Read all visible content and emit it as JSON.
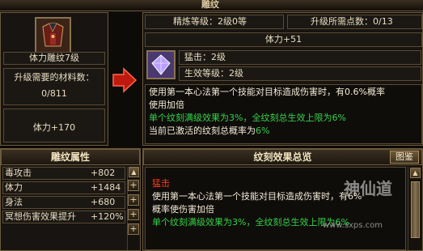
{
  "window": {
    "title": "雕纹"
  },
  "left": {
    "item_name": "体力雕纹7级",
    "materials_label": "升级需要的材料数：",
    "materials_value": "0/811",
    "stat_value": "体力+170"
  },
  "right_top": {
    "refine_level": "精炼等级：2级0等",
    "upgrade_points": "升级所需点数：0/13",
    "stat_bar": "体力+51",
    "skill_name": "猛击：2级",
    "effect_level": "生效等级：2级",
    "desc_line1": "使用第一本心法第一个技能对目标造成伤害时，有0.6%概率",
    "desc_line2": "使用加倍",
    "desc_green1": "单个纹刻满级效果为3%，全纹刻总生效上限为6%",
    "desc_line3_prefix": "当前已激活的纹刻总概率为",
    "desc_line3_value": "6%"
  },
  "attr_panel": {
    "title": "雕纹属性",
    "rows": [
      {
        "name": "毒攻击",
        "value": "+802"
      },
      {
        "name": "体力",
        "value": "+1484"
      },
      {
        "name": "身法",
        "value": "+680"
      },
      {
        "name": "冥想伤害效果提升",
        "value": "+120%"
      }
    ]
  },
  "summary_panel": {
    "title": "纹刻效果总览",
    "legend_button": "图鉴",
    "entry_name": "猛击",
    "entry_line1": "使用第一本心法第一个技能对目标造成伤害时，有6%",
    "entry_line2": "概率使伤害加倍",
    "entry_green": "单个纹刻满级效果为3%，全纹刻总生效上限为6%"
  },
  "watermark": {
    "text": "神仙道",
    "url": "www.sxps.com"
  },
  "colors": {
    "accent_green": "#35d24a",
    "accent_red": "#ff3a22",
    "border_gold": "#6b5a3e"
  }
}
